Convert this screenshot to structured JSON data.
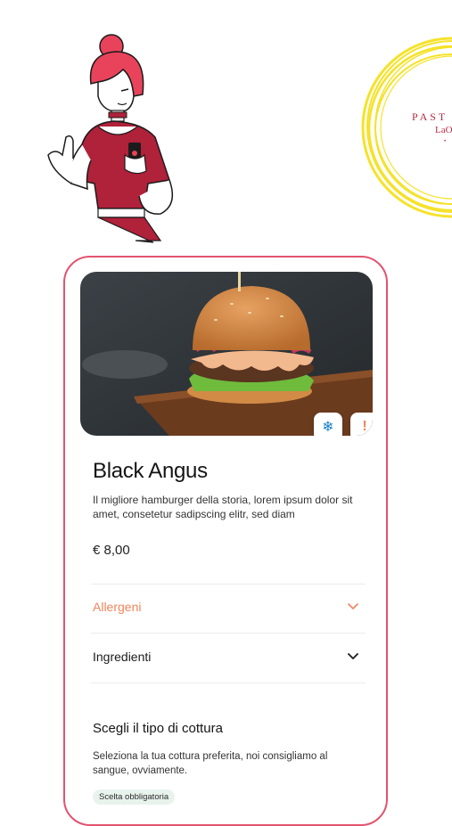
{
  "brand": {
    "logo_line1": "PAST",
    "logo_line2": "LaO",
    "logo_line3": "• •"
  },
  "product": {
    "name": "Black Angus",
    "description": "Il migliore hamburger della storia, lorem ipsum dolor sit amet, consetetur sadipscing elitr, sed diam",
    "price": "€ 8,00",
    "badges": [
      {
        "name": "snowflake-icon",
        "glyph": "❄",
        "color": "#1a7fc4"
      },
      {
        "name": "exclamation-icon",
        "glyph": "!",
        "color": "#f0845c"
      }
    ]
  },
  "accordion": {
    "allergens_label": "Allergeni",
    "ingredients_label": "Ingredienti"
  },
  "cooking": {
    "title": "Scegli il tipo di cottura",
    "description": "Seleziona la tua cottura preferita, noi consigliamo al sangue, ovviamente.",
    "required_badge": "Scelta obbligatoria"
  },
  "colors": {
    "card_border": "#e3536f",
    "accent_orange": "#f0845c",
    "pill_bg": "#e9f3ee"
  }
}
